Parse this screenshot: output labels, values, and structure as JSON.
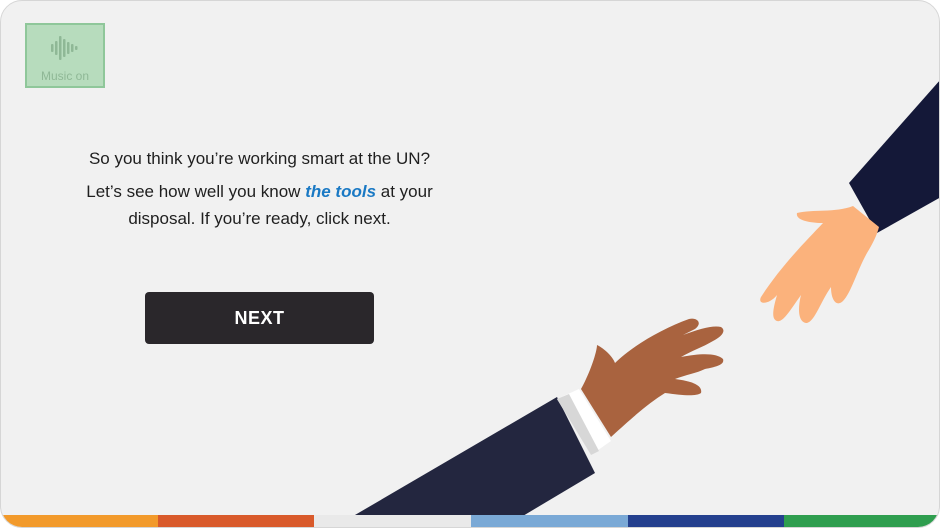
{
  "music_button": {
    "label": "Music on",
    "icon": "sound-wave-icon"
  },
  "intro": {
    "line1": "So you think you’re working smart at the UN?",
    "line2_before": "Let’s see how well you know ",
    "line2_emphasis": "the tools",
    "line2_after": " at your disposal. If you’re ready, click next."
  },
  "next_button": {
    "label": "NEXT"
  },
  "illustration": {
    "description_icon": "reaching-hands-illustration"
  },
  "colors": {
    "background": "#f1f1f1",
    "next_button": "#2a272b",
    "emphasis": "#1a79c4",
    "music_button": "#b7dcbd",
    "bottom_bar": [
      "#f29a2b",
      "#d95a2b",
      "#e9e9e9",
      "#7aa9d6",
      "#24408e",
      "#2f9e4f"
    ]
  }
}
